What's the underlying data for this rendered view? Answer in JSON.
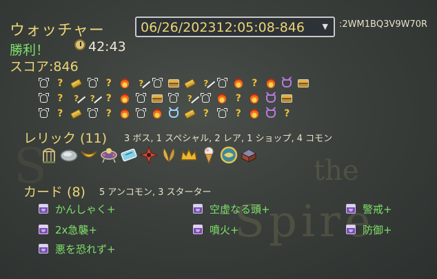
{
  "run": {
    "character": "ウォッチャー",
    "result": "勝利！",
    "time": "42:43",
    "score": "スコア:846",
    "seed": "2WM1BQ3V9W70R"
  },
  "run_selector": {
    "selected": "06/26/202312:05:08-846"
  },
  "path": {
    "rows": [
      [
        "monster",
        "unknown",
        "elite-gold",
        "monster",
        "unknown",
        "rest",
        "unknown-shop",
        "monster",
        "treasure",
        "elite-gold",
        "unknown-shop",
        "monster",
        "rest",
        "unknown",
        "rest",
        "boss",
        "treasure"
      ],
      [
        "monster",
        "unknown",
        "unknown-shop",
        "unknown-shop",
        "unknown",
        "rest",
        "monster",
        "treasure",
        "monster",
        "unknown-shop",
        "monster",
        "rest",
        "unknown",
        "rest",
        "boss",
        "treasure"
      ],
      [
        "monster",
        "unknown",
        "elite-gold",
        "monster",
        "unknown",
        "rest",
        "monster",
        "rest",
        "elite-blue",
        "elite-gold",
        "unknown",
        "monster",
        "unknown",
        "rest",
        "boss",
        "unknown"
      ]
    ]
  },
  "relics": {
    "title": "レリック (11)",
    "summary": "3 ボス, 1 スペシャル, 2 レア, 1 ショップ, 4 コモン",
    "items": [
      {
        "icon": "cage-icon"
      },
      {
        "icon": "stone-icon"
      },
      {
        "icon": "banana-icon"
      },
      {
        "icon": "lantern-icon"
      },
      {
        "icon": "ticket-icon"
      },
      {
        "icon": "shuriken-icon"
      },
      {
        "icon": "leaves-icon"
      },
      {
        "icon": "crown-icon"
      },
      {
        "icon": "ice-cream-icon"
      },
      {
        "icon": "medallion-icon"
      },
      {
        "icon": "chest-icon"
      }
    ]
  },
  "cards": {
    "title": "カード (8)",
    "summary": "5 アンコモン, 3 スターター",
    "items": [
      {
        "name": "かんしゃく+",
        "type": "skill"
      },
      {
        "name": "2x急襲+",
        "type": "attack"
      },
      {
        "name": "悪を恐れず+",
        "type": "skill"
      },
      {
        "name": "空虚なる頭+",
        "type": "skill"
      },
      {
        "name": "噴火+",
        "type": "attack"
      },
      {
        "name": "警戒+",
        "type": "skill"
      },
      {
        "name": "防御+",
        "type": "skill"
      }
    ]
  }
}
